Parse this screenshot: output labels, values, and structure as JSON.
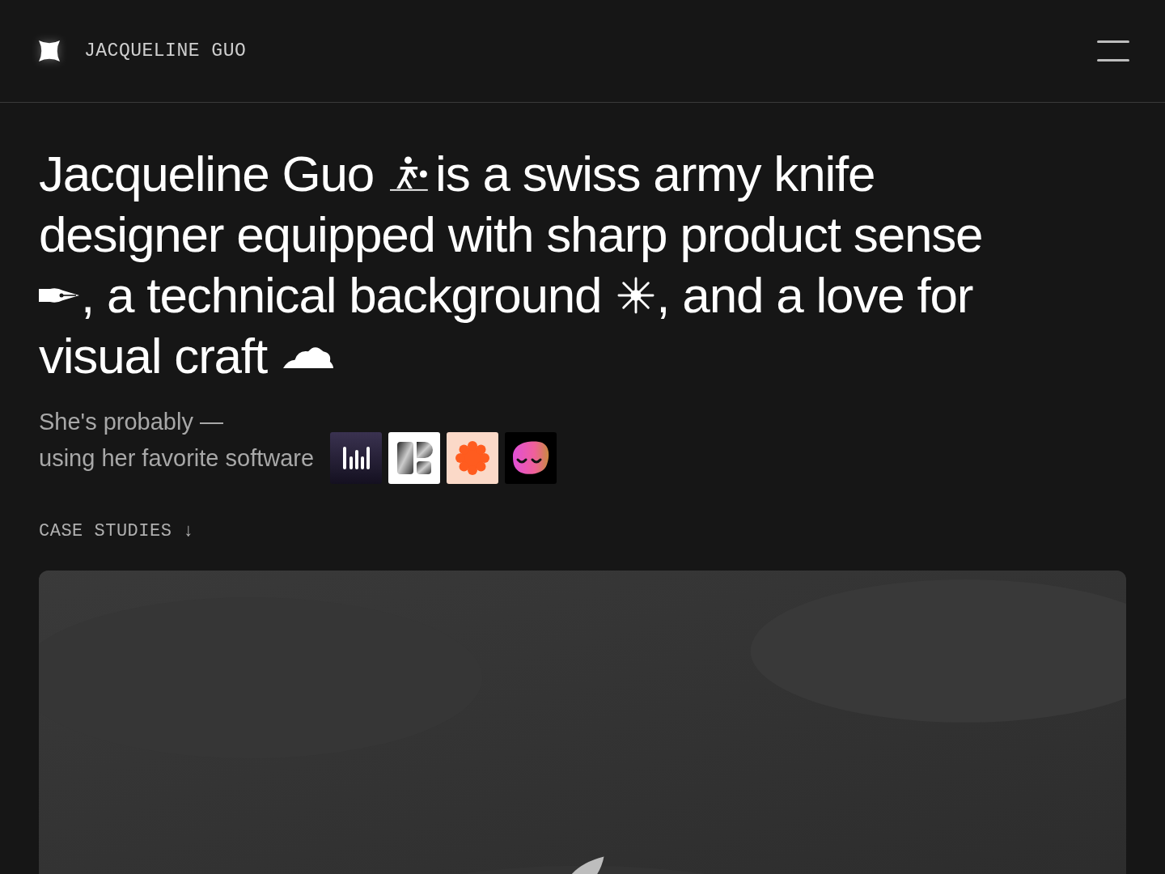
{
  "header": {
    "site_name": "JACQUELINE GUO"
  },
  "headline_lines": [
    [
      {
        "kind": "text",
        "text": "Jacqueline Guo"
      },
      {
        "kind": "icon"
      },
      {
        "kind": "text",
        "text": "is a swiss army knife"
      }
    ],
    [
      {
        "kind": "text",
        "text": "designer equipped with sharp product sense"
      }
    ],
    [
      {
        "kind": "icon"
      },
      {
        "kind": "text",
        "text": ", a technical background"
      },
      {
        "kind": "icon"
      },
      {
        "kind": "text",
        "text": ", and a love for"
      }
    ],
    [
      {
        "kind": "text",
        "text": "visual craft"
      },
      {
        "kind": "icon"
      }
    ]
  ],
  "subtitle": {
    "line_1": "She's probably —",
    "line_2": "using her favorite software"
  },
  "section_label": {
    "text": "CASE STUDIES",
    "arrow": "↓"
  },
  "case_study": {
    "kind": "picture"
  }
}
